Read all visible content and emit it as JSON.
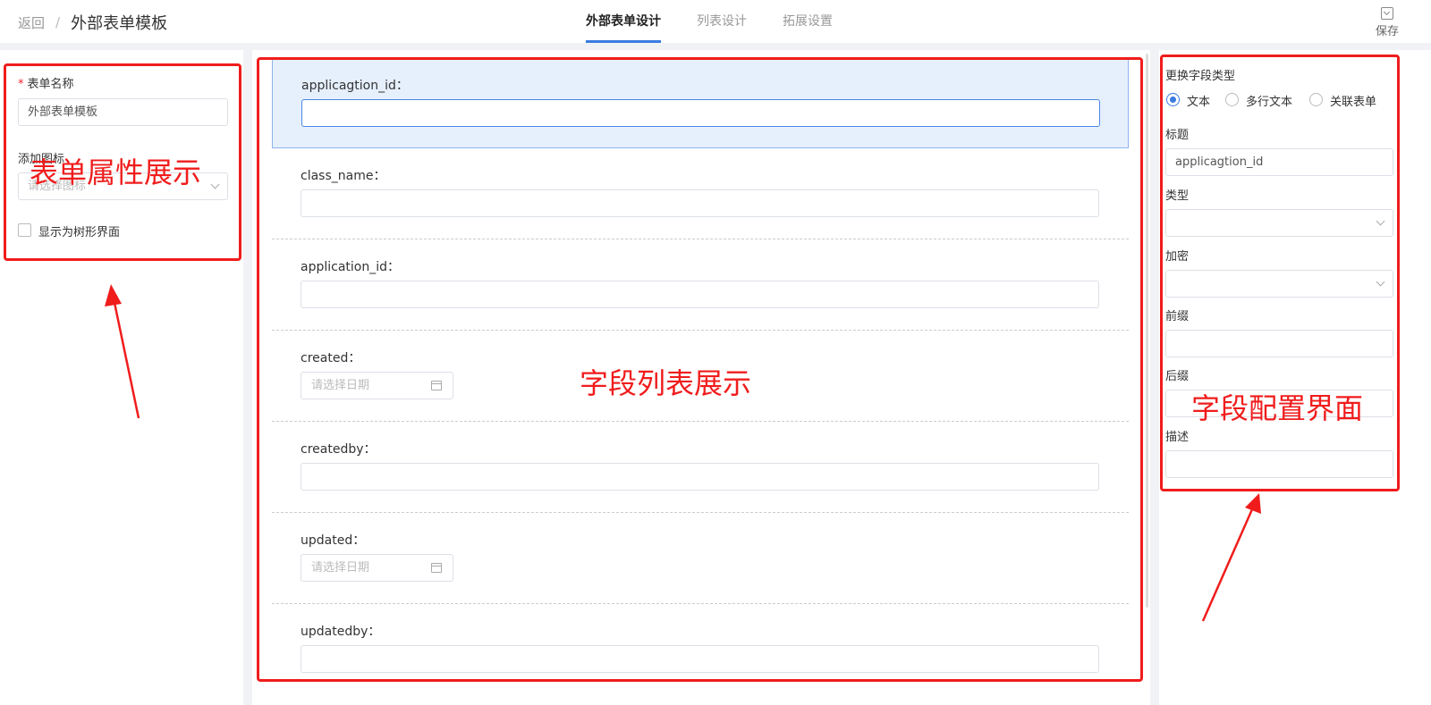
{
  "header": {
    "back_label": "返回",
    "separator": "/",
    "page_title": "外部表单模板",
    "tabs": [
      {
        "label": "外部表单设计",
        "active": true
      },
      {
        "label": "列表设计",
        "active": false
      },
      {
        "label": "拓展设置",
        "active": false
      }
    ],
    "save_label": "保存",
    "save_icon": "save-icon"
  },
  "left_panel": {
    "form_name_label": "表单名称",
    "form_name_value": "外部表单模板",
    "icon_label": "添加图标",
    "icon_placeholder": "请选择图标",
    "tree_view_label": "显示为树形界面"
  },
  "fields": [
    {
      "label": "applicagtion_id：",
      "kind": "text",
      "selected": true
    },
    {
      "label": "class_name：",
      "kind": "text"
    },
    {
      "label": "application_id：",
      "kind": "text"
    },
    {
      "label": "created：",
      "kind": "date",
      "placeholder": "请选择日期"
    },
    {
      "label": "createdby：",
      "kind": "text"
    },
    {
      "label": "updated：",
      "kind": "date",
      "placeholder": "请选择日期"
    },
    {
      "label": "updatedby：",
      "kind": "text"
    }
  ],
  "right_panel": {
    "change_type_label": "更换字段类型",
    "type_options": [
      "文本",
      "多行文本",
      "关联表单"
    ],
    "selected_type": "文本",
    "title_label": "标题",
    "title_value": "applicagtion_id",
    "type_label": "类型",
    "encrypt_label": "加密",
    "prefix_label": "前缀",
    "suffix_label": "后缀",
    "description_label": "描述"
  },
  "annotations": {
    "left": "表单属性展示",
    "center": "字段列表展示",
    "right": "字段配置界面",
    "color": "#f01c1c"
  }
}
